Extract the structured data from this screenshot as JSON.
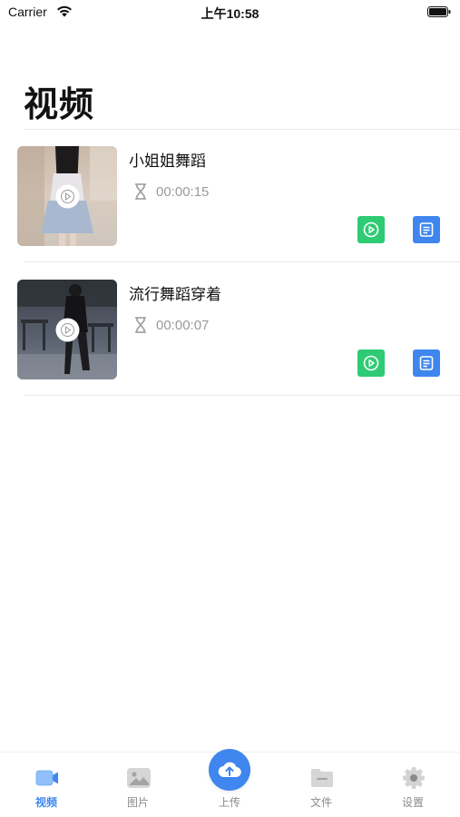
{
  "status_bar": {
    "carrier": "Carrier",
    "time": "上午10:58"
  },
  "page": {
    "title": "视频"
  },
  "videos": [
    {
      "title": "小姐姐舞蹈",
      "duration": "00:00:15"
    },
    {
      "title": "流行舞蹈穿着",
      "duration": "00:00:07"
    }
  ],
  "tabs": [
    {
      "label": "视频",
      "icon": "video-icon",
      "active": true
    },
    {
      "label": "图片",
      "icon": "image-icon",
      "active": false
    },
    {
      "label": "上传",
      "icon": "cloud-upload-icon",
      "active": false
    },
    {
      "label": "文件",
      "icon": "folder-icon",
      "active": false
    },
    {
      "label": "设置",
      "icon": "gear-icon",
      "active": false
    }
  ],
  "colors": {
    "accent": "#3f86ee",
    "play_button": "#2fcb74",
    "detail_button": "#3f86ee",
    "muted_text": "#9a9a9a"
  }
}
